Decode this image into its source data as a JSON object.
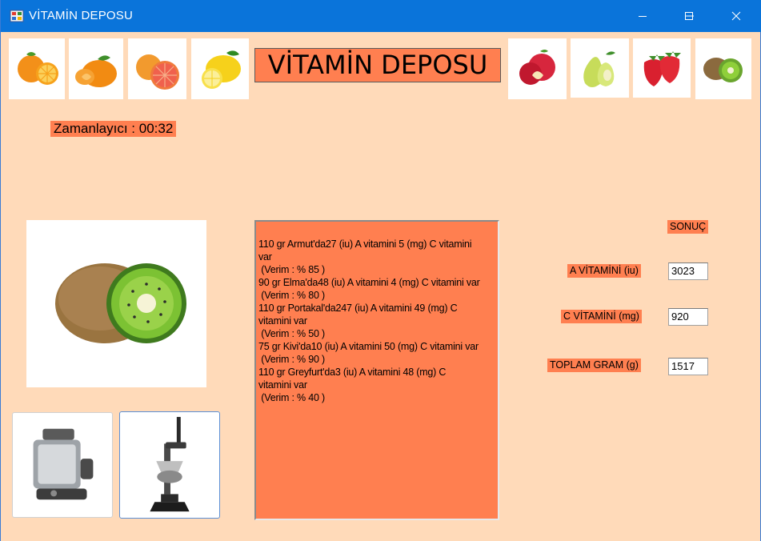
{
  "window": {
    "title": "VİTAMİN DEPOSU",
    "controls": {
      "minimize": "—",
      "maximize": "☐",
      "close": "✕"
    }
  },
  "header": {
    "brand_label": "VİTAMİN DEPOSU",
    "left_fruits": [
      "orange-icon",
      "mandarin-icon",
      "grapefruit-icon",
      "lemon-icon"
    ],
    "right_fruits": [
      "apple-icon",
      "pear-icon",
      "strawberry-icon",
      "kiwi-icon"
    ]
  },
  "timer": {
    "label": "Zamanlayıcı : 00:32"
  },
  "preview": {
    "icon": "kiwi-preview-icon"
  },
  "machines": {
    "juicer": "juicer-icon",
    "press": "citrus-press-icon"
  },
  "memo": {
    "lines": [
      "110 gr Armut'da27 (iu) A vitamini 5 (mg) C vitamini",
      "var",
      " (Verim : % 85 )",
      "90 gr Elma'da48 (iu) A vitamini 4 (mg) C vitamini var",
      " (Verim : % 80 )",
      "110 gr Portakal'da247 (iu) A vitamini 49 (mg) C",
      "vitamini var",
      " (Verim : % 50 )",
      "75 gr Kivi'da10 (iu) A vitamini 50 (mg) C vitamini var",
      " (Verim : % 90 )",
      "110 gr Greyfurt'da3 (iu) A vitamini 48 (mg) C",
      "vitamini var",
      " (Verim : % 40 )"
    ]
  },
  "results": {
    "heading": "SONUÇ",
    "a_vitamin_label": "A VİTAMİNİ (iu)",
    "a_vitamin_value": "3023",
    "c_vitamin_label": "C VİTAMİNİ (mg)",
    "c_vitamin_value": "920",
    "total_label": "TOPLAM GRAM (g)",
    "total_value": "1517"
  },
  "colors": {
    "titlebar": "#0a74da",
    "background": "#ffdab9",
    "accent": "#ff7f50"
  }
}
